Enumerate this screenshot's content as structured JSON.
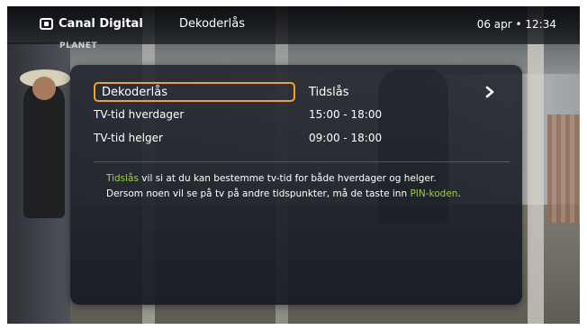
{
  "top_bar": {
    "brand": "Canal Digital",
    "title": "Dekoderlås",
    "clock": "06 apr • 12:34"
  },
  "channel_logo": "PLANET",
  "menu": {
    "rows": [
      {
        "label": "Dekoderlås",
        "value": "Tidslås",
        "selected": true
      },
      {
        "label": "TV-tid hverdager",
        "value": "15:00 - 18:00"
      },
      {
        "label": "TV-tid helger",
        "value": "09:00 - 18:00"
      }
    ]
  },
  "info": {
    "line1_hl": "Tidslås",
    "line1_rest": " vil si at du kan bestemme tv-tid for både hverdager og helger.",
    "line2_start": "Dersom noen vil se på tv på andre tidspunkter, må de taste inn ",
    "line2_hl": "PIN-koden",
    "line2_end": "."
  },
  "colors": {
    "focus_border": "#f0a31c",
    "highlight_text": "#9bd241"
  },
  "icons": [
    "brand-logo-icon",
    "chevron-right-icon"
  ]
}
